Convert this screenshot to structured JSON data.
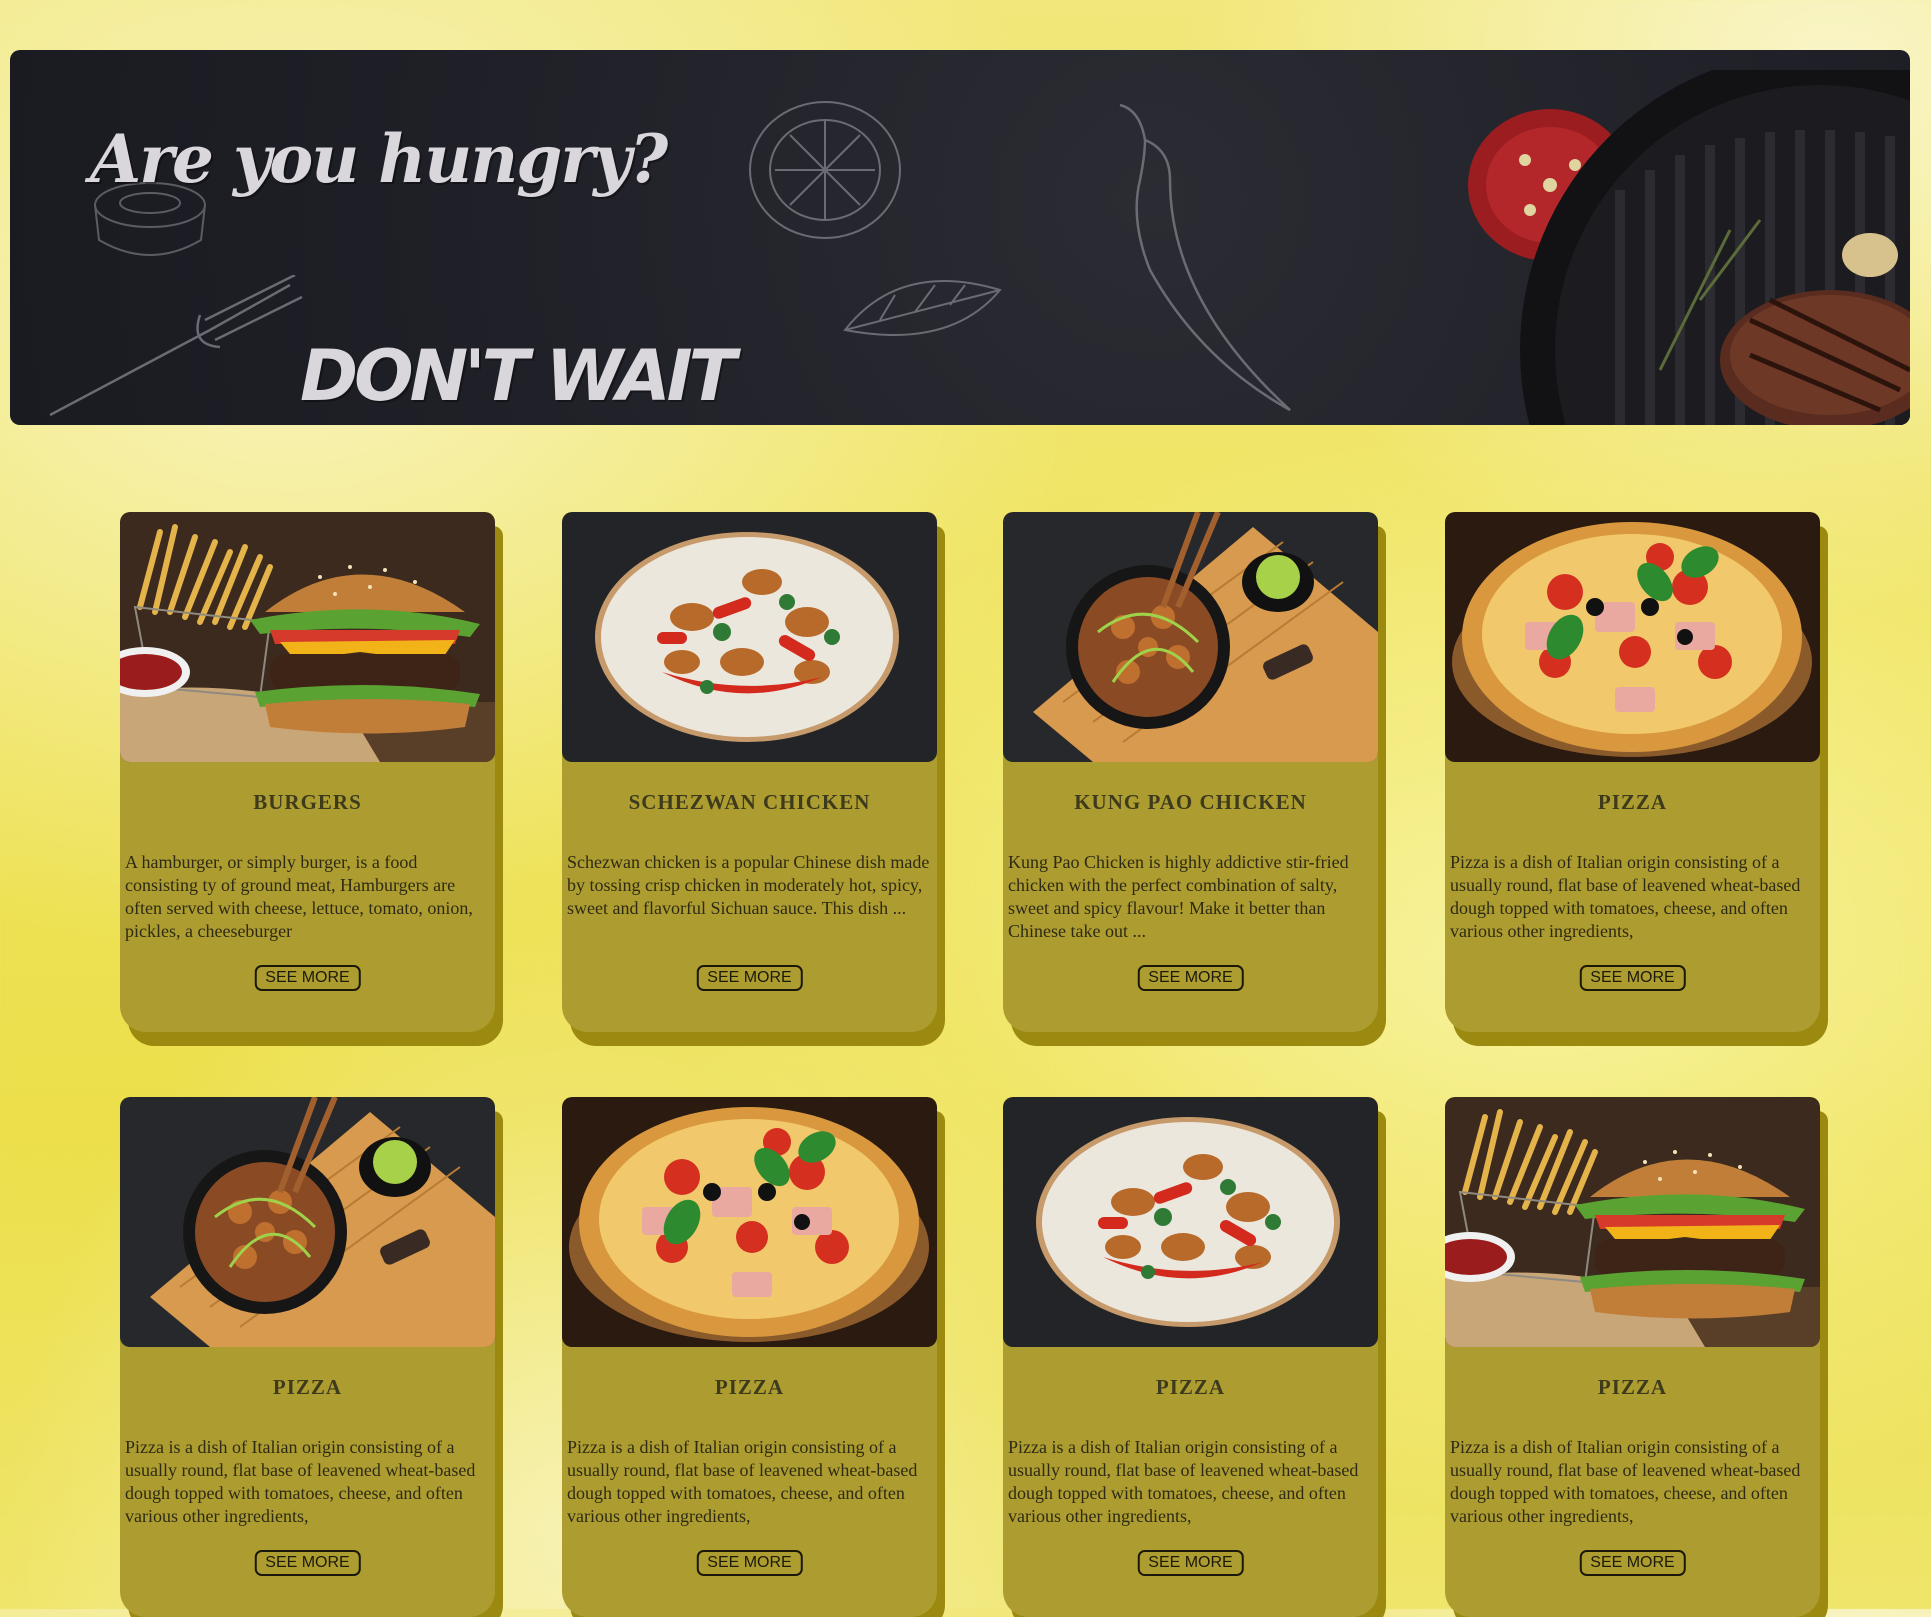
{
  "banner": {
    "title": "Are you hungry?",
    "tagline": "DON'T WAIT"
  },
  "colors": {
    "background": "#efe45f",
    "banner": "#1f2027",
    "card": "#ad9d31",
    "card_shadow": "#9c8a10",
    "button_border": "#1a1808"
  },
  "cards": [
    {
      "title": "BURGERS",
      "image": "burger-image",
      "description": "A hamburger, or simply burger, is a food consisting ty of ground meat, Hamburgers are often served with cheese, lettuce, tomato, onion, pickles, a cheeseburger",
      "button": "SEE MORE"
    },
    {
      "title": "SCHEZWAN CHICKEN",
      "image": "schezwan-chicken-image",
      "description": "Schezwan chicken is a popular Chinese dish made by tossing crisp chicken in moderately hot, spicy, sweet and flavorful Sichuan sauce. This dish ...",
      "button": "SEE MORE"
    },
    {
      "title": "KUNG PAO CHICKEN",
      "image": "kung-pao-chicken-image",
      "description": "Kung Pao Chicken is highly addictive stir-fried chicken with the perfect combination of salty, sweet and spicy flavour! Make it better than Chinese take out ...",
      "button": "SEE MORE"
    },
    {
      "title": "PIZZA",
      "image": "pizza-image",
      "description": "Pizza is a dish of Italian origin consisting of a usually round, flat base of leavened wheat-based dough topped with tomatoes, cheese, and often various other ingredients,",
      "button": "SEE MORE"
    },
    {
      "title": "PIZZA",
      "image": "kung-pao-chicken-image",
      "description": "Pizza is a dish of Italian origin consisting of a usually round, flat base of leavened wheat-based dough topped with tomatoes, cheese, and often various other ingredients,",
      "button": "SEE MORE"
    },
    {
      "title": "PIZZA",
      "image": "pizza-image",
      "description": "Pizza is a dish of Italian origin consisting of a usually round, flat base of leavened wheat-based dough topped with tomatoes, cheese, and often various other ingredients,",
      "button": "SEE MORE"
    },
    {
      "title": "PIZZA",
      "image": "schezwan-chicken-image",
      "description": "Pizza is a dish of Italian origin consisting of a usually round, flat base of leavened wheat-based dough topped with tomatoes, cheese, and often various other ingredients,",
      "button": "SEE MORE"
    },
    {
      "title": "PIZZA",
      "image": "burger-image",
      "description": "Pizza is a dish of Italian origin consisting of a usually round, flat base of leavened wheat-based dough topped with tomatoes, cheese, and often various other ingredients,",
      "button": "SEE MORE"
    }
  ]
}
